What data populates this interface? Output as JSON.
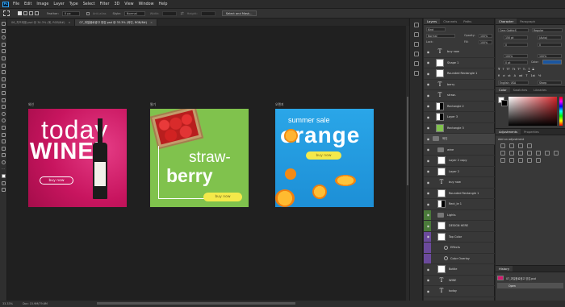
{
  "menubar": {
    "logo": "Ps",
    "items": [
      "File",
      "Edit",
      "Image",
      "Layer",
      "Type",
      "Select",
      "Filter",
      "3D",
      "View",
      "Window",
      "Help"
    ]
  },
  "options": {
    "feather_label": "Feather:",
    "feather_value": "0 px",
    "antialias_label": "Anti-alias",
    "style_label": "Style:",
    "style_value": "Normal",
    "width_label": "Width:",
    "height_label": "Height:",
    "select_mask": "Select and Mask..."
  },
  "tabs": [
    {
      "label": "06_치즈제품.psd @ 34.3% (메, RGB/8#)",
      "active": false
    },
    {
      "label": "07_과일음료광고 양감.psd @ 33.3% (와인, RGB/8#)",
      "active": true
    }
  ],
  "artboards": [
    {
      "label": "와인",
      "headline1": "today",
      "headline2": "WINE",
      "button": "buy now",
      "bg": "#d11b6e"
    },
    {
      "label": "딸기",
      "headline1": "straw-",
      "headline2": "berry",
      "button": "buy now",
      "bg": "#7cc24c"
    },
    {
      "label": "오렌지",
      "headline1": "summer sale",
      "headline2": "orange",
      "button": "buy now",
      "bg": "#29a6e8"
    }
  ],
  "layers": {
    "tabs": [
      "Layers",
      "Channels",
      "Paths"
    ],
    "kind": "Kind",
    "blend": "Normal",
    "opacity_label": "Opacity:",
    "opacity": "100%",
    "lock_label": "Lock:",
    "fill_label": "Fill:",
    "fill": "100%",
    "rows": [
      {
        "name": "buy now",
        "type": "text"
      },
      {
        "name": "Shape 1",
        "type": "thumb"
      },
      {
        "name": "Rounded Rectangle 1",
        "type": "thumb"
      },
      {
        "name": "berry",
        "type": "text"
      },
      {
        "name": "straw-",
        "type": "text"
      },
      {
        "name": "Rectangle 2",
        "type": "mask"
      },
      {
        "name": "Layer 3",
        "type": "mask"
      },
      {
        "name": "Rectangle 3",
        "type": "green"
      },
      {
        "name": "와인",
        "type": "artboard"
      },
      {
        "name": "wine",
        "type": "folder"
      },
      {
        "name": "Layer 2 copy",
        "type": "thumb"
      },
      {
        "name": "Layer 2",
        "type": "thumb"
      },
      {
        "name": "buy now",
        "type": "text"
      },
      {
        "name": "Rounded Rectangle 1",
        "type": "thumb"
      },
      {
        "name": "Rect_le 1",
        "type": "mask"
      },
      {
        "name": "Lights",
        "type": "folder"
      },
      {
        "name": "DESIGN HERE",
        "type": "thumb"
      },
      {
        "name": "Top Color",
        "type": "thumb"
      },
      {
        "name": "Effects",
        "type": "fx"
      },
      {
        "name": "Color Overlay",
        "type": "fx2"
      },
      {
        "name": "Bottle",
        "type": "thumb"
      },
      {
        "name": "WINE",
        "type": "text"
      },
      {
        "name": "today",
        "type": "text"
      }
    ]
  },
  "character": {
    "tabs": [
      "Character",
      "Paragraph"
    ],
    "font": "Cera GothicS",
    "style": "Regular",
    "size": "150 pt",
    "leading": "(Auto)",
    "kerning": "0",
    "tracking": "0",
    "vscale": "100%",
    "hscale": "100%",
    "baseline": "0 pt",
    "color_label": "Color:",
    "language": "English: USA",
    "aa": "Sharp",
    "color": "#1b56a0"
  },
  "color": {
    "tabs": [
      "Color",
      "Swatches",
      "Libraries"
    ],
    "fg": "#ffffff",
    "bg": "#000000",
    "hue": "#d4272c"
  },
  "adjustments": {
    "tabs": [
      "Adjustments",
      "Properties"
    ],
    "add_label": "Add an adjustment"
  },
  "history": {
    "tab": "History",
    "doc": "07_과일음료광고 양감.psd",
    "items": [
      "Open"
    ]
  },
  "status": {
    "zoom": "33.33%",
    "doc": "Doc: 15.9M/79.6M"
  }
}
